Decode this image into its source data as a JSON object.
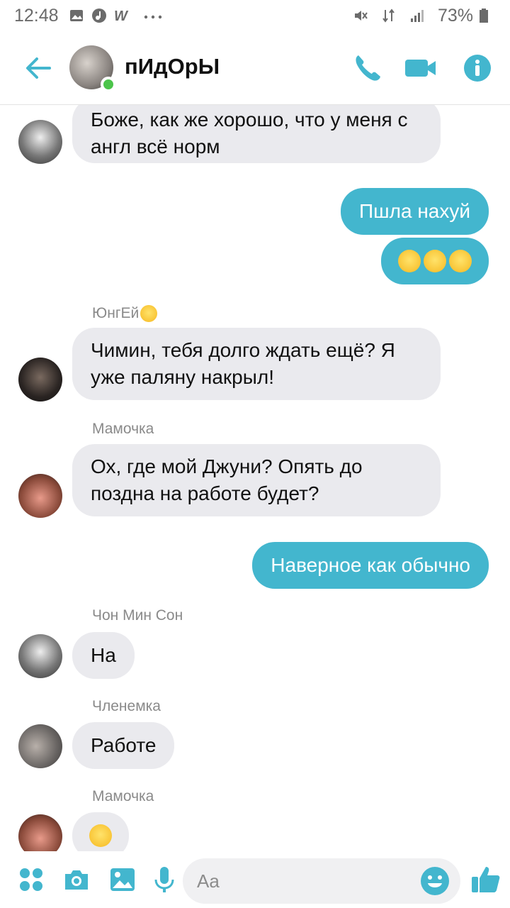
{
  "status_bar": {
    "time": "12:48",
    "battery": "73%"
  },
  "header": {
    "title": "пИдОрЫ"
  },
  "messages": [
    {
      "type": "in",
      "text": "Боже, как же хорошо, что у меня с англ всё норм"
    },
    {
      "type": "out",
      "text": "Пшла нахуй"
    },
    {
      "type": "out",
      "emoji": "😂😂😂"
    },
    {
      "type": "in",
      "sender": "ЮнгЕй",
      "sender_emoji": "😂",
      "text": "Чимин, тебя долго ждать ещё? Я уже паляну накрыл!"
    },
    {
      "type": "in",
      "sender": "Мамочка",
      "text": "Ох, где мой Джуни? Опять до поздна на работе будет?"
    },
    {
      "type": "out",
      "text": "Наверное как обычно"
    },
    {
      "type": "in",
      "sender": "Чон Мин Сон",
      "text": "На"
    },
    {
      "type": "in",
      "sender": "Членемка",
      "text": "Работе"
    },
    {
      "type": "in",
      "sender": "Мамочка",
      "emoji": "😔"
    }
  ],
  "composer": {
    "placeholder": "Aa"
  },
  "colors": {
    "accent": "#43b6ce",
    "incoming_bubble": "#eaeaee",
    "online": "#4cc44a"
  }
}
